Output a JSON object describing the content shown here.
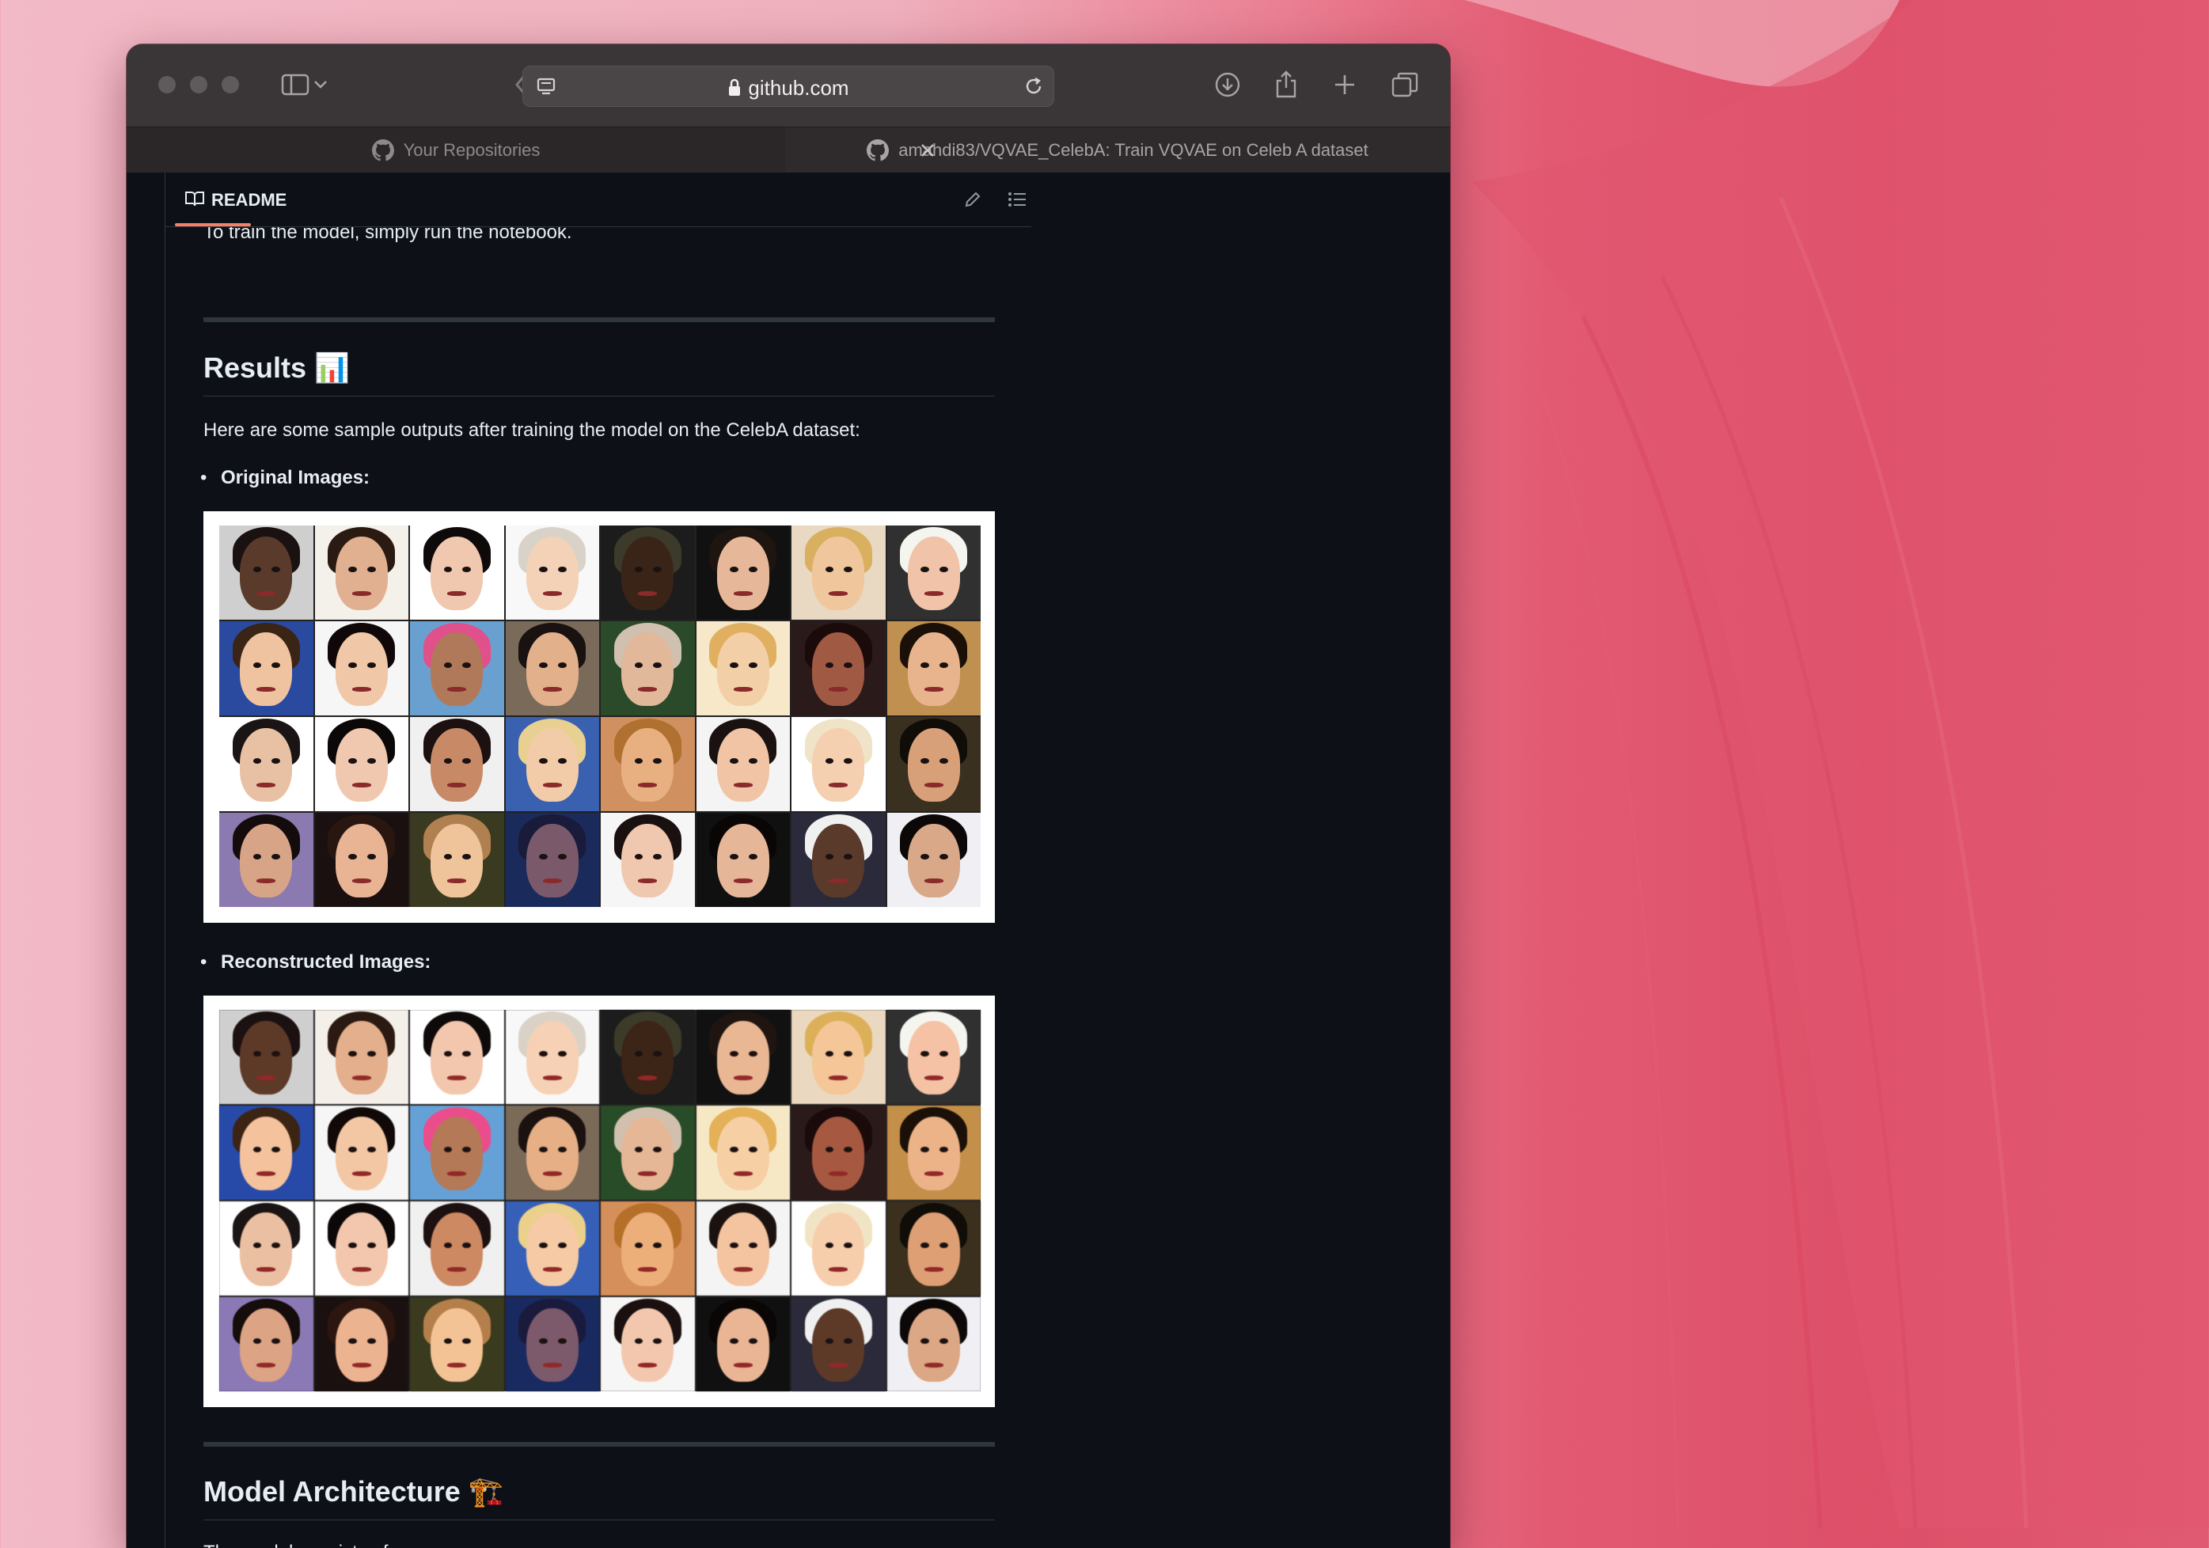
{
  "browser": {
    "url": "github.com",
    "tabs": [
      {
        "label": "Your Repositories",
        "active": false
      },
      {
        "label": "amahdi83/VQVAE_CelebA: Train VQVAE on Celeb A dataset",
        "active": true
      }
    ],
    "icons": [
      "sidebar-icon",
      "chevron-down-icon",
      "back-icon",
      "forward-icon",
      "site-icon",
      "lock-icon",
      "reload-icon",
      "download-icon",
      "share-icon",
      "plus-icon",
      "tabs-overview-icon",
      "github-icon",
      "close-icon"
    ]
  },
  "readme": {
    "header_label": "README",
    "icons": [
      "book-icon",
      "pencil-icon",
      "list-icon"
    ],
    "clipped_line": "To train the model, simply run the notebook.",
    "results_heading": "Results 📊",
    "results_intro": "Here are some sample outputs after training the model on the CelebA dataset:",
    "original_label": "Original Images:",
    "reconstructed_label": "Reconstructed Images:",
    "arch_heading": "Model Architecture 🏗️",
    "arch_intro": "The model consists of:"
  },
  "image_grid": {
    "rows": 4,
    "cols": 8,
    "cells": [
      {
        "skin": "#5a3a2a",
        "hair": "#1a1111",
        "bg": "#cfcfcf"
      },
      {
        "skin": "#e0b090",
        "hair": "#2a1a12",
        "bg": "#f4f0ea"
      },
      {
        "skin": "#f0c8b0",
        "hair": "#0f0a0a",
        "bg": "#ffffff"
      },
      {
        "skin": "#f3d2b8",
        "hair": "#d9d2c8",
        "bg": "#f8f8f8"
      },
      {
        "skin": "#3a2418",
        "hair": "#3c3a2a",
        "bg": "#1c1c1c"
      },
      {
        "skin": "#e6b899",
        "hair": "#1e1410",
        "bg": "#111111"
      },
      {
        "skin": "#f0c79d",
        "hair": "#d8b060",
        "bg": "#e9d9c2"
      },
      {
        "skin": "#f1c3a8",
        "hair": "#f5f5f0",
        "bg": "#303030"
      },
      {
        "skin": "#f0c3a0",
        "hair": "#3a2416",
        "bg": "#2a4aa0"
      },
      {
        "skin": "#f0c8a8",
        "hair": "#100808",
        "bg": "#f6f6f6"
      },
      {
        "skin": "#b07a5a",
        "hair": "#e0508a",
        "bg": "#6aa0d0"
      },
      {
        "skin": "#e2b08a",
        "hair": "#1a1210",
        "bg": "#7a6a5a"
      },
      {
        "skin": "#e2b89a",
        "hair": "#d0c0b0",
        "bg": "#2a4a2a"
      },
      {
        "skin": "#f3cfa8",
        "hair": "#e0b060",
        "bg": "#f6e8c8"
      },
      {
        "skin": "#a05a44",
        "hair": "#1a0a0a",
        "bg": "#2a1a1a"
      },
      {
        "skin": "#e8b48e",
        "hair": "#1a1008",
        "bg": "#c09050"
      },
      {
        "skin": "#e8c0a4",
        "hair": "#1a1414",
        "bg": "#ffffff"
      },
      {
        "skin": "#f0c8b0",
        "hair": "#0c0808",
        "bg": "#ffffff"
      },
      {
        "skin": "#c88a66",
        "hair": "#1c1010",
        "bg": "#f0f0f0"
      },
      {
        "skin": "#f2cba8",
        "hair": "#e8d090",
        "bg": "#3a60b0"
      },
      {
        "skin": "#e8b080",
        "hair": "#b07030",
        "bg": "#d09060"
      },
      {
        "skin": "#f0c4a4",
        "hair": "#1a1210",
        "bg": "#f4f4f4"
      },
      {
        "skin": "#f4cfb0",
        "hair": "#f0e4c8",
        "bg": "#ffffff"
      },
      {
        "skin": "#d8a078",
        "hair": "#100c08",
        "bg": "#3a3020"
      },
      {
        "skin": "#d8a488",
        "hair": "#140c0c",
        "bg": "#8a7ab0"
      },
      {
        "skin": "#e8b494",
        "hair": "#2a1610",
        "bg": "#1a1010"
      },
      {
        "skin": "#f0c49a",
        "hair": "#b08050",
        "bg": "#3a3a20"
      },
      {
        "skin": "#7a5a6a",
        "hair": "#1a1a3a",
        "bg": "#1a2a5a"
      },
      {
        "skin": "#f0c8b0",
        "hair": "#1a1010",
        "bg": "#f6f6f6"
      },
      {
        "skin": "#e6b698",
        "hair": "#0a0606",
        "bg": "#101010"
      },
      {
        "skin": "#5a3a2a",
        "hair": "#f0f0f0",
        "bg": "#2a2a3a"
      },
      {
        "skin": "#d8a888",
        "hair": "#0c0808",
        "bg": "#f0f0f4"
      }
    ]
  }
}
